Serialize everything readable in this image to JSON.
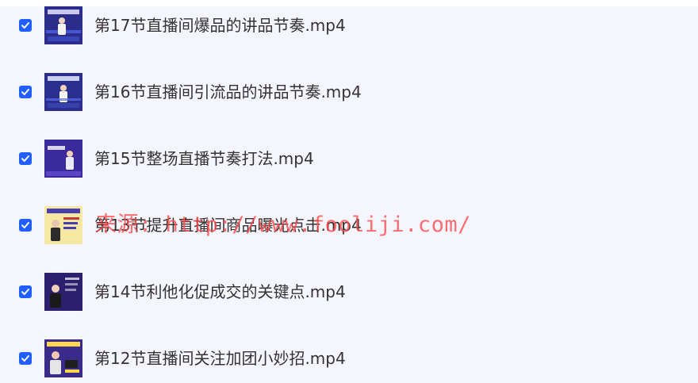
{
  "colors": {
    "checkbox": "#1f5eff",
    "panel_background": "#f5f6fd",
    "text": "#333333",
    "watermark": "#ff4646"
  },
  "files": [
    {
      "name": "第17节直播间爆品的讲品节奏.mp4",
      "checked": true,
      "thumb_style": "classroom"
    },
    {
      "name": "第16节直播间引流品的讲品节奏.mp4",
      "checked": true,
      "thumb_style": "classroom"
    },
    {
      "name": "第15节整场直播节奏打法.mp4",
      "checked": true,
      "thumb_style": "presenter-purple"
    },
    {
      "name": "第13节提升直播间商品曝光点击.mp4",
      "checked": true,
      "thumb_style": "poster"
    },
    {
      "name": "第14节利他化促成交的关键点.mp4",
      "checked": true,
      "thumb_style": "presenter-dark"
    },
    {
      "name": "第12节直播间关注加团小妙招.mp4",
      "checked": true,
      "thumb_style": "poster-dark"
    }
  ],
  "watermark": {
    "text": "来源: http://www.fooliji.com/"
  },
  "icons": {
    "check": "check-icon",
    "thumbnail": "video-thumbnail"
  }
}
